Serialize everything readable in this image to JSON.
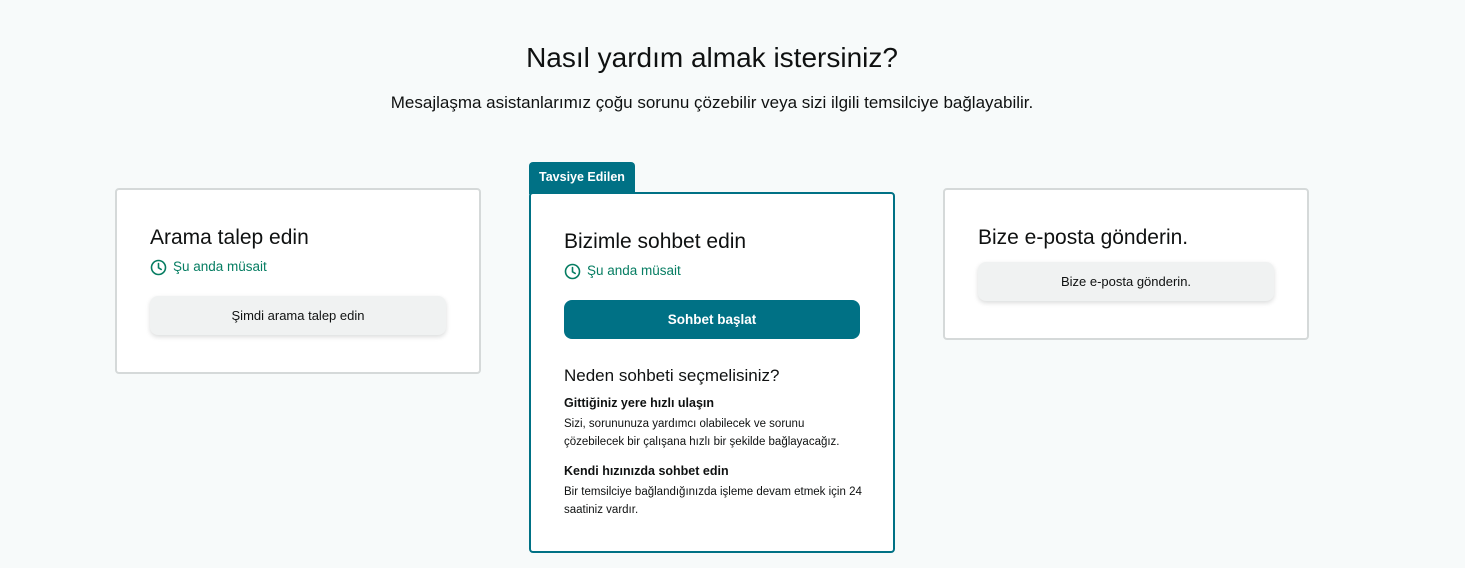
{
  "header": {
    "title": "Nasıl yardım almak istersiniz?",
    "subtitle": "Mesajlaşma asistanlarımız çoğu sorunu çözebilir veya sizi ilgili temsilciye bağlayabilir."
  },
  "cards": {
    "call": {
      "title": "Arama talep edin",
      "status": "Şu anda müsait",
      "button": "Şimdi arama talep edin"
    },
    "chat": {
      "badge": "Tavsiye Edilen",
      "title": "Bizimle sohbet edin",
      "status": "Şu anda müsait",
      "button": "Sohbet başlat",
      "why_title": "Neden sohbeti seçmelisiniz?",
      "benefits": [
        {
          "title": "Gittiğiniz yere hızlı ulaşın",
          "text": "Sizi, sorununuza yardımcı olabilecek ve sorunu çözebilecek bir çalışana hızlı bir şekilde bağlayacağız."
        },
        {
          "title": "Kendi hızınızda sohbet edin",
          "text": "Bir temsilciye bağlandığınızda işleme devam etmek için 24 saatiniz vardır."
        }
      ]
    },
    "email": {
      "title": "Bize e-posta gönderin.",
      "button": "Bize e-posta gönderin."
    }
  },
  "icons": {
    "status": "clock-icon"
  },
  "colors": {
    "accent": "#007185",
    "available": "#067d62",
    "background": "#f7fafa",
    "card_border": "#d5d9d9"
  }
}
